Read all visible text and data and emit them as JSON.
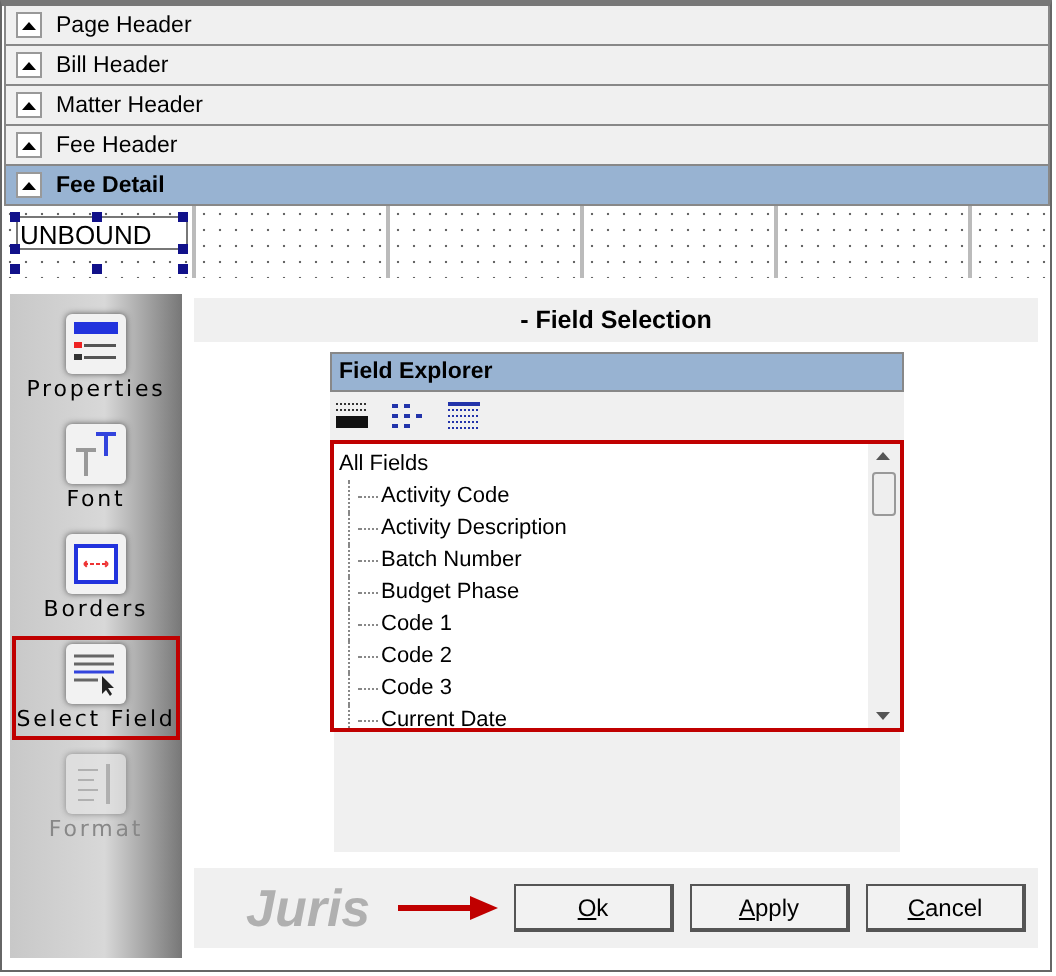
{
  "sections": [
    {
      "label": "Page Header",
      "selected": false
    },
    {
      "label": "Bill Header",
      "selected": false
    },
    {
      "label": "Matter Header",
      "selected": false
    },
    {
      "label": "Fee Header",
      "selected": false
    },
    {
      "label": "Fee Detail",
      "selected": true
    }
  ],
  "design_field": {
    "label": "UNBOUND",
    "selected": true
  },
  "tools": [
    {
      "kind": "properties",
      "label": "Properties",
      "selected": false,
      "disabled": false
    },
    {
      "kind": "font",
      "label": "Font",
      "selected": false,
      "disabled": false
    },
    {
      "kind": "borders",
      "label": "Borders",
      "selected": false,
      "disabled": false
    },
    {
      "kind": "select",
      "label": "Select Field",
      "selected": true,
      "disabled": false
    },
    {
      "kind": "format",
      "label": "Format",
      "selected": false,
      "disabled": true
    }
  ],
  "dialog": {
    "title": "- Field Selection",
    "explorer_title": "Field Explorer",
    "tree": {
      "label": "All Fields",
      "children": [
        {
          "label": "Activity Code"
        },
        {
          "label": "Activity Description"
        },
        {
          "label": "Batch Number"
        },
        {
          "label": "Budget Phase"
        },
        {
          "label": "Code 1"
        },
        {
          "label": "Code 2"
        },
        {
          "label": "Code 3"
        },
        {
          "label": "Current Date"
        }
      ]
    },
    "logo": "Juris",
    "buttons": [
      "Ok",
      "Apply",
      "Cancel"
    ]
  }
}
